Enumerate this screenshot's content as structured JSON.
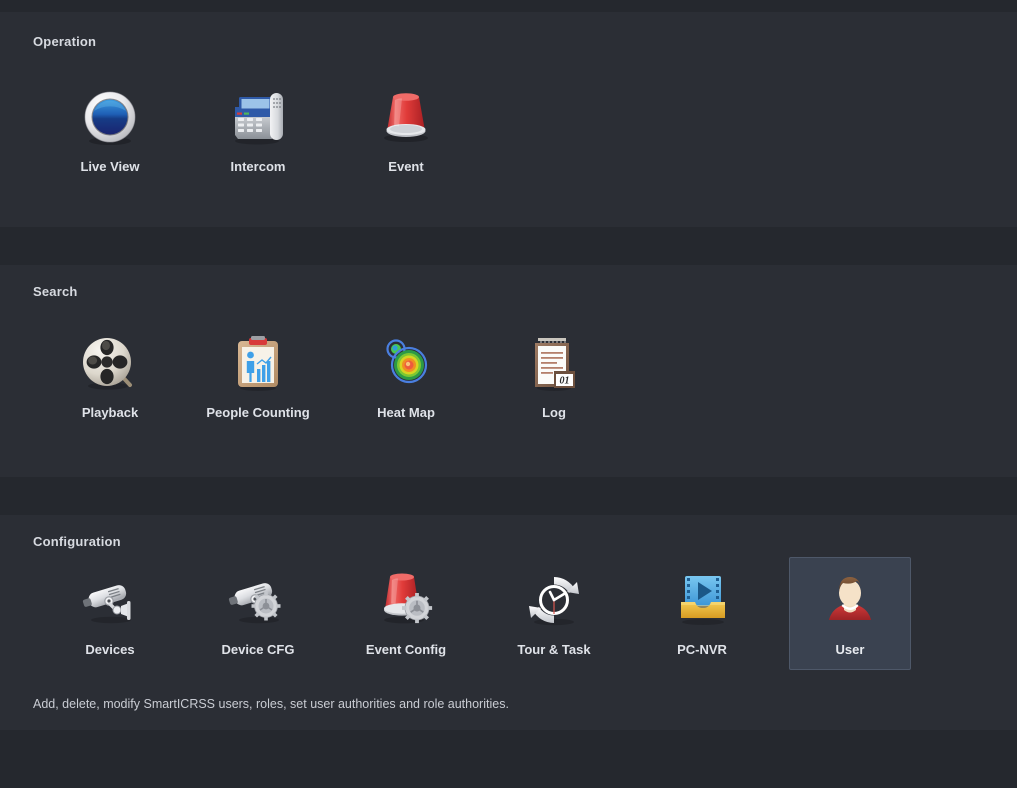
{
  "sections": [
    {
      "id": "operation",
      "title": "Operation",
      "tiles": [
        {
          "label": "Live View",
          "icon": "live-view-icon",
          "selected": false
        },
        {
          "label": "Intercom",
          "icon": "intercom-icon",
          "selected": false
        },
        {
          "label": "Event",
          "icon": "event-alarm-icon",
          "selected": false
        }
      ]
    },
    {
      "id": "search",
      "title": "Search",
      "tiles": [
        {
          "label": "Playback",
          "icon": "film-reel-icon",
          "selected": false
        },
        {
          "label": "People Counting",
          "icon": "clipboard-chart-icon",
          "selected": false
        },
        {
          "label": "Heat Map",
          "icon": "heat-map-icon",
          "selected": false
        },
        {
          "label": "Log",
          "icon": "notepad-log-icon",
          "selected": false
        }
      ]
    },
    {
      "id": "configuration",
      "title": "Configuration",
      "tiles": [
        {
          "label": "Devices",
          "icon": "camera-icon",
          "selected": false
        },
        {
          "label": "Device CFG",
          "icon": "camera-gear-icon",
          "selected": false
        },
        {
          "label": "Event Config",
          "icon": "alarm-gear-icon",
          "selected": false
        },
        {
          "label": "Tour & Task",
          "icon": "clock-refresh-icon",
          "selected": false
        },
        {
          "label": "PC-NVR",
          "icon": "video-folder-icon",
          "selected": false
        },
        {
          "label": "User",
          "icon": "user-avatar-icon",
          "selected": true
        }
      ]
    }
  ],
  "footer": {
    "description": "Add, delete, modify SmartICRSS users, roles, set user authorities and role authorities."
  },
  "colors": {
    "background": "#2b2e35",
    "band": "#25282e",
    "selection_fill": "#3a4250",
    "selection_border": "#4e5869",
    "title_text": "#d7dae0",
    "label_text": "#dfe2e8",
    "footer_text": "#c9ccd3"
  }
}
